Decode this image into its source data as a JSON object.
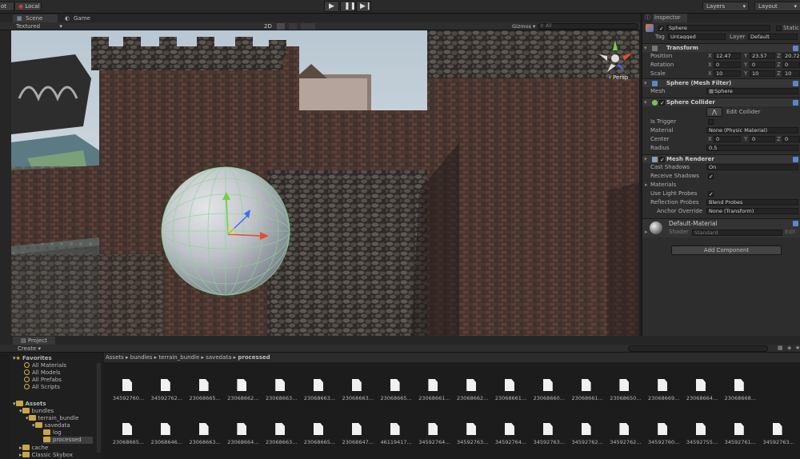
{
  "toolbar": {
    "left_button_1": "ot",
    "left_button_2": "Local",
    "play_icon": "play-icon",
    "pause_icon": "pause-icon",
    "step_icon": "step-icon",
    "layers_label": "Layers",
    "layout_label": "Layout"
  },
  "scene_tabs": [
    {
      "label": "Scene",
      "icon": "scene-icon"
    },
    {
      "label": "Game",
      "icon": "game-icon"
    }
  ],
  "scene_bar": {
    "shading_mode": "Textured",
    "mode_2d": "2D",
    "gizmos_label": "Gizmos",
    "search_placeholder": "All"
  },
  "viewport": {
    "persp_label": "Persp",
    "gizmo_axes": [
      "x",
      "y",
      "z"
    ]
  },
  "inspector": {
    "tab_label": "Inspector",
    "object_name": "Sphere",
    "static_label": "Static",
    "tag_label": "Tag",
    "tag_value": "Untagged",
    "layer_label": "Layer",
    "layer_value": "Default",
    "transform": {
      "title": "Transform",
      "position_label": "Position",
      "position": {
        "x": "12.47",
        "y": "23.57",
        "z": "20.72"
      },
      "rotation_label": "Rotation",
      "rotation": {
        "x": "0",
        "y": "0",
        "z": "0"
      },
      "scale_label": "Scale",
      "scale": {
        "x": "10",
        "y": "10",
        "z": "10"
      }
    },
    "mesh_filter": {
      "title": "Sphere (Mesh Filter)",
      "mesh_label": "Mesh",
      "mesh_value": "Sphere"
    },
    "sphere_collider": {
      "title": "Sphere Collider",
      "edit_collider_label": "Edit Collider",
      "is_trigger_label": "Is Trigger",
      "material_label": "Material",
      "material_value": "None (Physic Material)",
      "center_label": "Center",
      "center": {
        "x": "0",
        "y": "0",
        "z": "0"
      },
      "radius_label": "Radius",
      "radius_value": "0.5"
    },
    "mesh_renderer": {
      "title": "Mesh Renderer",
      "cast_shadows_label": "Cast Shadows",
      "cast_shadows_value": "On",
      "receive_shadows_label": "Receive Shadows",
      "materials_label": "Materials",
      "use_light_probes_label": "Use Light Probes",
      "reflection_probes_label": "Reflection Probes",
      "reflection_probes_value": "Blend Probes",
      "anchor_override_label": "Anchor Override",
      "anchor_override_value": "None (Transform)"
    },
    "material": {
      "title": "Default-Material",
      "shader_label": "Shader",
      "shader_value": "Standard",
      "edit_label": "Edit"
    },
    "add_component_label": "Add Component"
  },
  "project": {
    "tab_label": "Project",
    "create_label": "Create",
    "tree": [
      {
        "label": "Favorites",
        "type": "favorites"
      },
      {
        "label": "All Materials",
        "type": "search"
      },
      {
        "label": "All Models",
        "type": "search"
      },
      {
        "label": "All Prefabs",
        "type": "search"
      },
      {
        "label": "All Scripts",
        "type": "search"
      },
      {
        "label": "Assets",
        "type": "folder"
      },
      {
        "label": "bundles",
        "type": "folder"
      },
      {
        "label": "terrain_bundle",
        "type": "folder"
      },
      {
        "label": "savedata",
        "type": "folder"
      },
      {
        "label": "log",
        "type": "folder"
      },
      {
        "label": "processed",
        "type": "folder",
        "selected": true
      },
      {
        "label": "cache",
        "type": "folder"
      },
      {
        "label": "Classic Skybox",
        "type": "folder"
      }
    ],
    "breadcrumb": [
      "Assets",
      "bundles",
      "terrain_bundle",
      "savedata",
      "processed"
    ],
    "files_row1": [
      "34592760...",
      "34592762...",
      "23068665...",
      "23068662...",
      "23068663...",
      "23068663...",
      "23068663...",
      "23068665...",
      "23068661...",
      "23068662...",
      "23068661...",
      "23068660...",
      "23068661...",
      "23068650...",
      "23068669...",
      "23068664...",
      "23068668..."
    ],
    "files_row2": [
      "23068665...",
      "23068646...",
      "23068663...",
      "23068664...",
      "23068663...",
      "23068665...",
      "23068647...",
      "46119417...",
      "34592764...",
      "34592763...",
      "34592764...",
      "34592763...",
      "34592762...",
      "34592762...",
      "34592760...",
      "34592755...",
      "34592761...",
      "34592763..."
    ]
  },
  "colors": {
    "accent_blue": "#5a88c8",
    "folder_yellow": "#c9a64a",
    "selection": "#3d3d3d",
    "panel_bg": "#2d2d2d"
  }
}
